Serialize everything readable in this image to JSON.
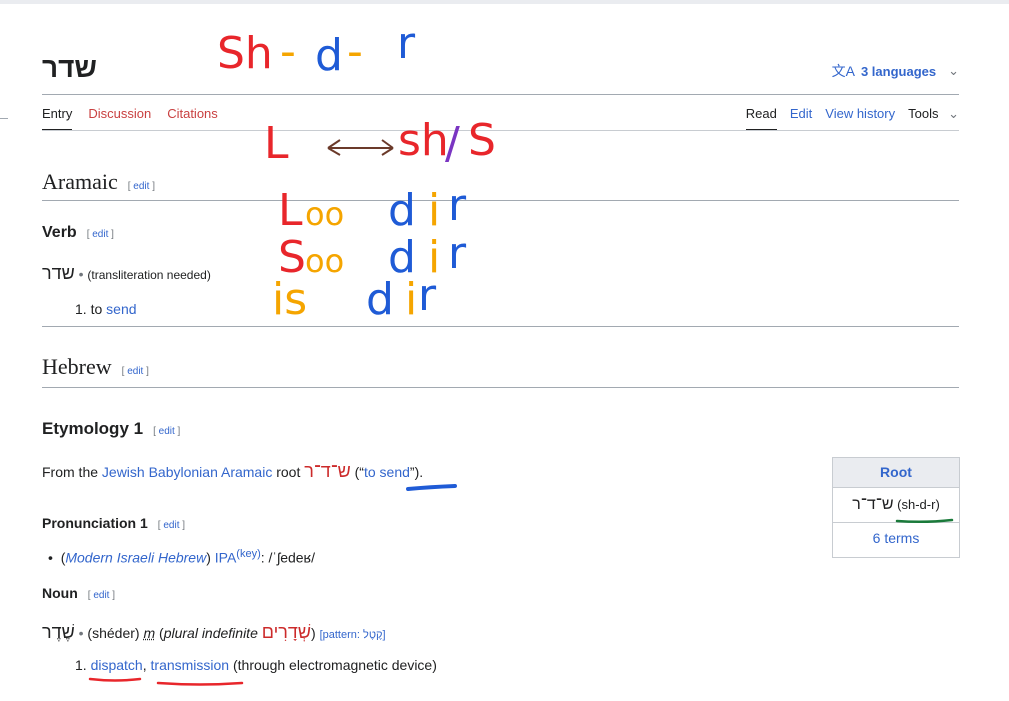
{
  "title": "שדר",
  "languages_button": "3 languages",
  "tabs_left": [
    "Entry",
    "Discussion",
    "Citations"
  ],
  "tabs_right": [
    "Read",
    "Edit",
    "View history",
    "Tools"
  ],
  "edit_label": "edit",
  "aramaic": {
    "heading": "Aramaic",
    "pos": "Verb",
    "headword": "שדר",
    "translit": "(transliteration needed)",
    "def_num": "1.",
    "def_prefix": "to",
    "def_link": "send"
  },
  "hebrew": {
    "heading": "Hebrew",
    "etymology_heading": "Etymology 1",
    "etym_prefix": "From the",
    "etym_link": "Jewish Babylonian Aramaic",
    "etym_mid": "root",
    "etym_root": "ש־ד־ר",
    "etym_gloss_open": "(“",
    "etym_gloss_link": "to send",
    "etym_gloss_close": "”).",
    "pronunciation_heading": "Pronunciation 1",
    "pron_variety": "Modern Israeli Hebrew",
    "pron_ipa": "IPA",
    "pron_key": "(key)",
    "pron_value": ": /ˈʃedeʁ/",
    "noun_heading": "Noun",
    "noun_headword": "שֶׁדֶר",
    "noun_translit": "(shéder)",
    "noun_gender": "m",
    "noun_plural_label": "plural indefinite",
    "noun_plural": "שְׁדָרִים",
    "noun_pattern": "[pattern: קֶטֶל]",
    "def_num": "1.",
    "def_link1": "dispatch",
    "def_link2": "transmission",
    "def_rest": "(through electromagnetic device)"
  },
  "root_box": {
    "header": "Root",
    "root": "ש־ד־ר",
    "root_translit": "(sh-d-r)",
    "terms": "6 terms"
  },
  "annotations": {
    "line1": [
      "Sh",
      "-",
      "d",
      "-",
      "r"
    ],
    "line2_left": "L",
    "line2_right_a": "sh",
    "line2_slash": "/",
    "line2_right_b": "S",
    "row1": [
      "L",
      "oo",
      "d",
      "i",
      "r"
    ],
    "row2": [
      "S",
      "oo",
      "d",
      "i",
      "r"
    ],
    "row3": [
      "is",
      "d",
      "i",
      "r"
    ]
  },
  "colors": {
    "ann_red": "#e8262b",
    "ann_blue": "#1f5bd6",
    "ann_orange": "#f5a500",
    "ann_purple": "#7a35c2",
    "ann_brown": "#6b3a2a",
    "ann_green": "#1a7a3a"
  }
}
